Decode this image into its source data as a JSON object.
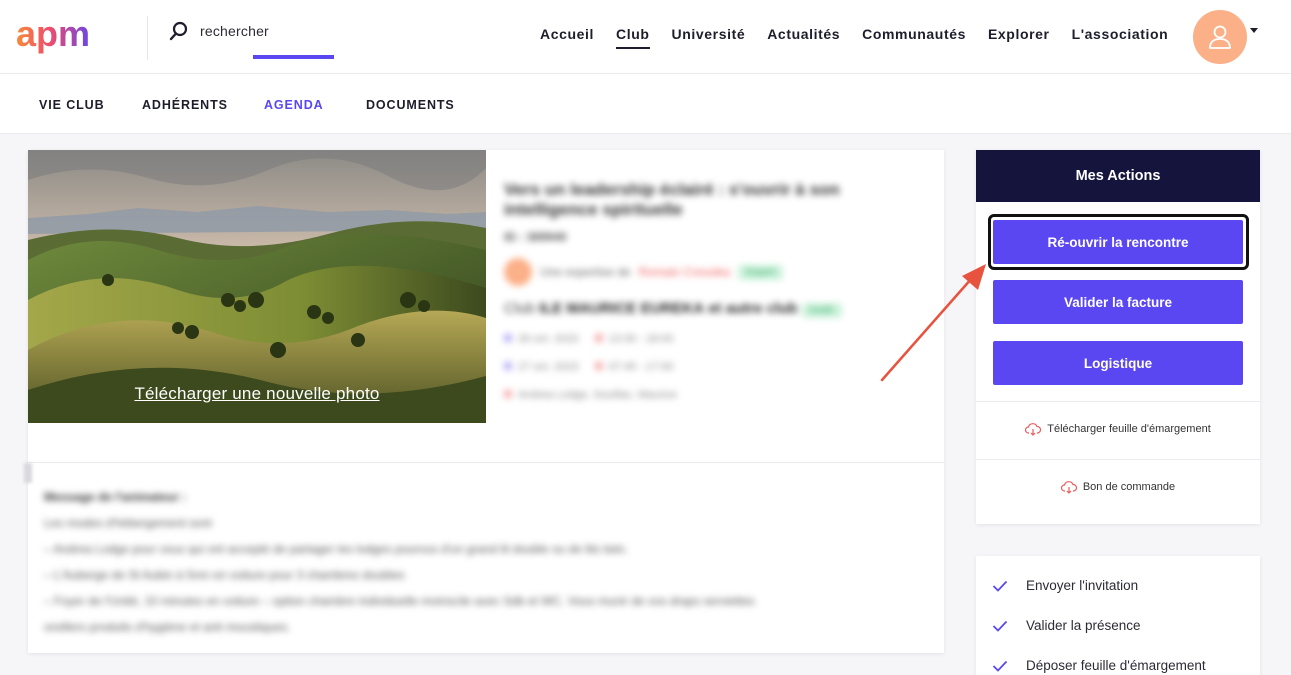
{
  "header": {
    "logo_text": "apm",
    "search_placeholder": "rechercher",
    "nav": [
      {
        "label": "Accueil",
        "active": false
      },
      {
        "label": "Club",
        "active": true
      },
      {
        "label": "Université",
        "active": false
      },
      {
        "label": "Actualités",
        "active": false
      },
      {
        "label": "Communautés",
        "active": false
      },
      {
        "label": "Explorer",
        "active": false
      },
      {
        "label": "L'association",
        "active": false
      }
    ],
    "avatar_color": "#fbb088"
  },
  "subnav": {
    "tabs": [
      {
        "label": "VIE CLUB",
        "active": false
      },
      {
        "label": "ADHÉRENTS",
        "active": false
      },
      {
        "label": "AGENDA",
        "active": true
      },
      {
        "label": "DOCUMENTS",
        "active": false
      }
    ],
    "accent_color": "#5a47f2"
  },
  "event": {
    "photo_link": "Télécharger une nouvelle photo",
    "title": "Vers un leadership éclairé : s'ouvrir à son intelligence spirituelle",
    "event_id": "ID : 389940",
    "expert_prefix": "Une expertise de",
    "expert_name": "Romain Cressika",
    "expert_badge": "Expert",
    "club_prefix": "Club",
    "club_name": "ILE MAURICE EUREKA",
    "club_and": "et",
    "club_other": "autre club",
    "club_badge": "Invité",
    "date1": "26 oct. 2023",
    "time1": "13:30 - 18:00",
    "date2": "27 oct. 2023",
    "time2": "07:45 - 17:00",
    "location": "Andrea Lodge, Souillac, Maurice",
    "message_title": "Message de l'animateur :",
    "message_lines": [
      "Les modes d'hébergement sont",
      "– Andrea Lodge pour ceux qui ont accepté de partager les lodges pourvus d'un grand lit double ou de lits twin.",
      "– L'Auberge de St Aubin à 5mn en voiture pour 3 chambres doubles",
      "– Foyer de l'Unité, 10 minutes en voiture – option chambre individuelle moinscile avec Sdb et WC. Vous munir de vos draps serviettes",
      "oreillers produits d'hygiène et anti moustiques."
    ]
  },
  "actions": {
    "title": "Mes Actions",
    "buttons": [
      "Ré-ouvrir la rencontre",
      "Valider la facture",
      "Logistique"
    ],
    "links": [
      "Télécharger feuille d'émargement",
      "Bon de commande"
    ],
    "button_color": "#5a47f2",
    "header_color": "#15143d"
  },
  "checklist": {
    "items": [
      "Envoyer l'invitation",
      "Valider la présence",
      "Déposer feuille d'émargement"
    ]
  }
}
